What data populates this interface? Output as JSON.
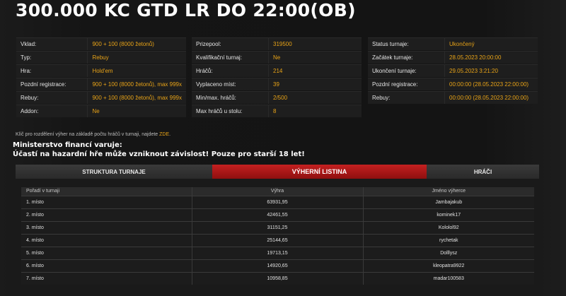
{
  "page": {
    "title": "300.000 KC GTD LR DO 22:00(OB)"
  },
  "info_col1": [
    {
      "label": "Vklad:",
      "value": "900 + 100 (8000 žetonů)"
    },
    {
      "label": "Typ:",
      "value": "Rebuy"
    },
    {
      "label": "Hra:",
      "value": "Hold'em"
    },
    {
      "label": "Pozdní registrace:",
      "value": "900 + 100 (8000 žetonů), max 999x"
    },
    {
      "label": "Rebuy:",
      "value": "900 + 100 (8000 žetonů), max 999x"
    },
    {
      "label": "Addon:",
      "value": "Ne"
    }
  ],
  "info_col2": [
    {
      "label": "Prizepool:",
      "value": "319500"
    },
    {
      "label": "Kvalifikační turnaj:",
      "value": "Ne"
    },
    {
      "label": "Hráčů:",
      "value": "214"
    },
    {
      "label": "Vyplaceno míst:",
      "value": "39"
    },
    {
      "label": "Min/max. hráčů:",
      "value": "2/500"
    },
    {
      "label": "Max hráčů u stolu:",
      "value": "8"
    }
  ],
  "info_col3": [
    {
      "label": "Status turnaje:",
      "value": "Ukončený"
    },
    {
      "label": "Začátek turnaje:",
      "value": "28.05.2023 20:00:00"
    },
    {
      "label": "Ukončení turnaje:",
      "value": "29.05.2023 3:21:20"
    },
    {
      "label": "Pozdní registrace:",
      "value": "00:00:00 (28.05.2023 22:00:00)"
    },
    {
      "label": "Rebuy:",
      "value": "00:00:00 (28.05.2023 22:00:00)"
    }
  ],
  "note": {
    "text": "Klíč pro rozdělení výher na základě počtu hráčů v turnaji, najdete ",
    "link": "ZDE",
    "end": "."
  },
  "warning": {
    "line1": "Ministerstvo financí varuje:",
    "line2": "Účastí na hazardní hře může vzniknout závislost! Pouze pro starší 18 let!"
  },
  "tabs": [
    {
      "label": "STRUKTURA TURNAJE"
    },
    {
      "label": "VÝHERNÍ LISTINA"
    },
    {
      "label": "HRÁČI"
    }
  ],
  "results": {
    "headers": [
      "Pořadí v turnaji",
      "Výhra",
      "Jméno výherce"
    ],
    "rows": [
      [
        "1. místo",
        "63931,95",
        "Jambajakub"
      ],
      [
        "2. místo",
        "42461,55",
        "kominek17"
      ],
      [
        "3. místo",
        "31151,25",
        "Kololol92"
      ],
      [
        "4. místo",
        "25144,65",
        "rychetak"
      ],
      [
        "5. místo",
        "19713,15",
        "Dolllysz"
      ],
      [
        "6. místo",
        "14920,65",
        "kleopatra9922"
      ],
      [
        "7. místo",
        "10958,85",
        "madar100583"
      ]
    ]
  },
  "colors": {
    "accent": "#e8a317",
    "tab_active": "#c42020"
  }
}
